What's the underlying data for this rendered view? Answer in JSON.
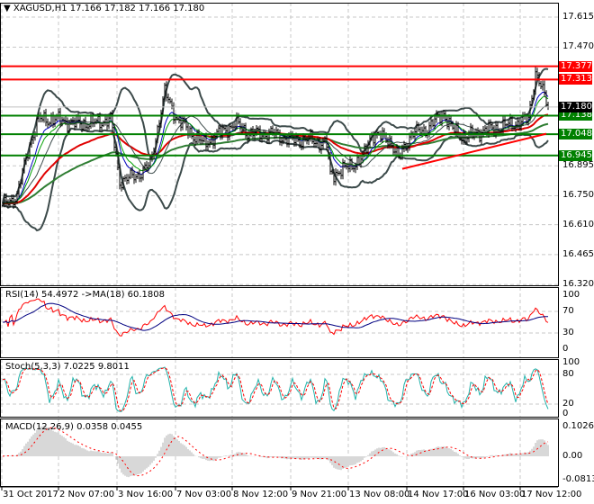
{
  "chart_data": {
    "type": "candlestick",
    "symbol_header": "XAGUSD,H1  17.166 17.182 17.166 17.180",
    "last_price": "17.180",
    "price_ylim": [
      16.316,
      17.685
    ],
    "price_ticks": [
      "17.615",
      "17.470",
      "16.895",
      "16.750",
      "16.610",
      "16.465",
      "16.320"
    ],
    "levels": [
      {
        "value": "17.377",
        "color": "#ff0000"
      },
      {
        "value": "17.313",
        "color": "#ff0000"
      },
      {
        "value": "17.138",
        "color": "#008000"
      },
      {
        "value": "17.048",
        "color": "#008000"
      },
      {
        "value": "16.945",
        "color": "#008000"
      }
    ],
    "trendline": {
      "from": [
        222,
        16.88
      ],
      "to": [
        302,
        17.05
      ],
      "color": "#ff0000"
    },
    "close_anchors": [
      [
        0,
        16.7
      ],
      [
        8,
        16.75
      ],
      [
        15,
        17.0
      ],
      [
        20,
        17.12
      ],
      [
        30,
        17.12
      ],
      [
        40,
        17.1
      ],
      [
        50,
        17.1
      ],
      [
        60,
        17.12
      ],
      [
        65,
        16.82
      ],
      [
        75,
        16.85
      ],
      [
        82,
        16.9
      ],
      [
        90,
        17.25
      ],
      [
        97,
        17.12
      ],
      [
        105,
        17.05
      ],
      [
        112,
        17.0
      ],
      [
        120,
        17.05
      ],
      [
        130,
        17.1
      ],
      [
        137,
        17.05
      ],
      [
        150,
        17.05
      ],
      [
        160,
        17.02
      ],
      [
        170,
        17.02
      ],
      [
        180,
        17.0
      ],
      [
        182,
        16.85
      ],
      [
        190,
        16.88
      ],
      [
        200,
        16.93
      ],
      [
        205,
        17.05
      ],
      [
        215,
        17.02
      ],
      [
        220,
        16.93
      ],
      [
        227,
        17.05
      ],
      [
        235,
        17.07
      ],
      [
        245,
        17.15
      ],
      [
        250,
        17.07
      ],
      [
        257,
        17.03
      ],
      [
        265,
        17.06
      ],
      [
        275,
        17.08
      ],
      [
        285,
        17.1
      ],
      [
        292,
        17.12
      ],
      [
        296,
        17.35
      ],
      [
        299,
        17.28
      ],
      [
        303,
        17.18
      ]
    ],
    "time_labels": [
      "31 Oct 2017",
      "2 Nov 07:00",
      "3 Nov 16:00",
      "7 Nov 03:00",
      "8 Nov 12:00",
      "9 Nov 21:00",
      "13 Nov 08:00",
      "14 Nov 17:00",
      "16 Nov 03:00",
      "17 Nov 12:00"
    ],
    "rsi": {
      "title": "RSI(14) 54.4972  ->MA(18) 60.1808",
      "ticks": [
        "100",
        "70",
        "30",
        "0"
      ]
    },
    "stoch": {
      "title": "Stoch(5,3,3) 7.0225 9.8011",
      "ticks": [
        "100",
        "80",
        "20",
        "0"
      ]
    },
    "macd": {
      "title": "MACD(12,26,9) 0.0358 0.0455",
      "ticks": [
        "0.1026",
        "0.00",
        "-0.0813"
      ]
    }
  }
}
